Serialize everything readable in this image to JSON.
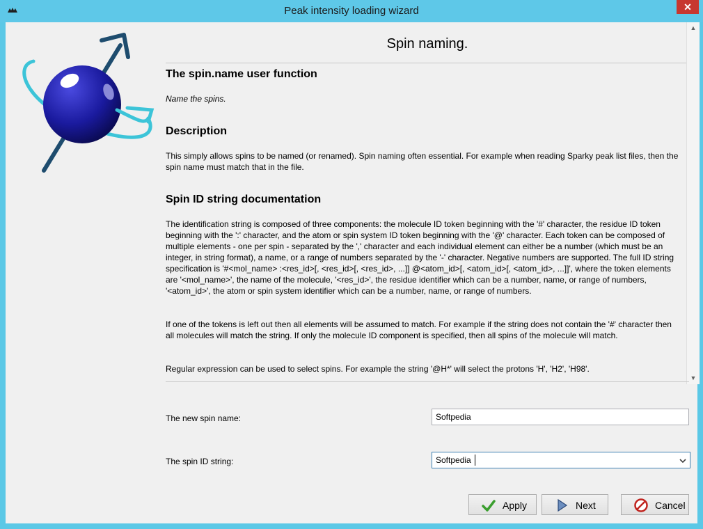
{
  "window": {
    "title": "Peak intensity loading wizard",
    "close_glyph": "✕"
  },
  "page": {
    "title": "Spin naming.",
    "section1_heading": "The spin.name user function",
    "section1_text": "Name the spins.",
    "description_heading": "Description",
    "description_text": "This simply allows spins to be named (or renamed).  Spin naming often essential.  For example when reading Sparky peak list files, then the spin name must match that in the file.",
    "spinid_heading": "Spin ID string documentation",
    "spinid_para1": "The identification string is composed of three components: the molecule ID token beginning with the '#' character, the residue ID token beginning with the ':' character, and the atom or spin system ID token beginning with the '@' character.  Each token can be composed of multiple elements - one per spin - separated by the ',' character and each individual element can either be a number (which must be an integer, in string format), a name, or a range of numbers separated by the '-' character.  Negative numbers are supported.  The full ID string specification is '#<mol_name> :<res_id>[, <res_id>[, <res_id>, ...]] @<atom_id>[, <atom_id>[, <atom_id>, ...]]', where the token elements are '<mol_name>', the name of the molecule, '<res_id>', the residue identifier which can be a number, name, or range of numbers, '<atom_id>', the atom or spin system identifier which can be a number, name, or range of numbers.",
    "spinid_para2": "If one of the tokens is left out then all elements will be assumed to match.  For example if the string does not contain the '#' character then all molecules will match the string.  If only the molecule ID component is specified, then all spins of the molecule will match.",
    "spinid_para3": "Regular expression can be used to select spins.  For example the string '@H*' will select the protons 'H', 'H2', 'H98'."
  },
  "form": {
    "new_name_label": "The new spin name:",
    "new_name_value": "Softpedia",
    "spin_id_label": "The spin ID string:",
    "spin_id_value": "Softpedia"
  },
  "buttons": {
    "apply": "Apply",
    "next": "Next",
    "cancel": "Cancel"
  },
  "colors": {
    "titlebar": "#5ec8e8",
    "logo_sphere": "#1a1a9e",
    "logo_ring": "#3cc4d8",
    "arrow": "#1e4c6e"
  }
}
